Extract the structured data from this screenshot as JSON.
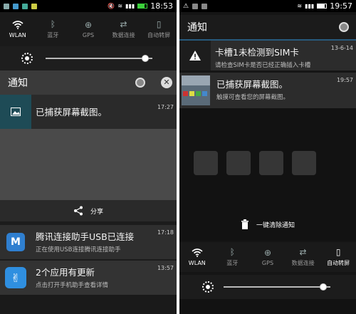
{
  "left": {
    "status": {
      "time": "18:53"
    },
    "quick_settings": [
      {
        "label": "WLAN",
        "icon": "wifi-icon",
        "active": true
      },
      {
        "label": "蓝牙",
        "icon": "bluetooth-icon",
        "active": false
      },
      {
        "label": "GPS",
        "icon": "gps-icon",
        "active": false
      },
      {
        "label": "数据连接",
        "icon": "data-sync-icon",
        "active": false
      },
      {
        "label": "自动转屏",
        "icon": "rotate-icon",
        "active": false
      }
    ],
    "brightness_level": 0.93,
    "header_title": "通知",
    "screenshot_notice": {
      "title": "已捕获屏幕截图。",
      "time": "17:27"
    },
    "share_label": "分享",
    "notifications": [
      {
        "title": "腾讯连接助手USB已连接",
        "subtitle": "正在使用USB连接腾讯连接助手",
        "time": "17:18"
      },
      {
        "title": "2个应用有更新",
        "subtitle": "点击打开手机助手查看详情",
        "time": "13:57"
      }
    ]
  },
  "right": {
    "status": {
      "time": "19:57"
    },
    "header_title": "通知",
    "notifications": [
      {
        "title": "卡槽1未检测到SIM卡",
        "subtitle": "请检查SIM卡是否已经正确插入卡槽",
        "time": "13-6-14"
      },
      {
        "title": "已捕获屏幕截图。",
        "subtitle": "触摸可查看您的屏幕截图。",
        "time": "19:57"
      }
    ],
    "clear_label": "一键清除通知",
    "quick_settings": [
      {
        "label": "WLAN",
        "icon": "wifi-icon",
        "active": true
      },
      {
        "label": "蓝牙",
        "icon": "bluetooth-icon",
        "active": false
      },
      {
        "label": "GPS",
        "icon": "gps-icon",
        "active": false
      },
      {
        "label": "数据连接",
        "icon": "data-sync-icon",
        "active": false
      },
      {
        "label": "自动转屏",
        "icon": "rotate-icon",
        "active": true
      }
    ],
    "brightness_level": 0.93
  },
  "colors": {
    "accent": "#3aa0e6",
    "battery_green": "#3bd23b"
  }
}
